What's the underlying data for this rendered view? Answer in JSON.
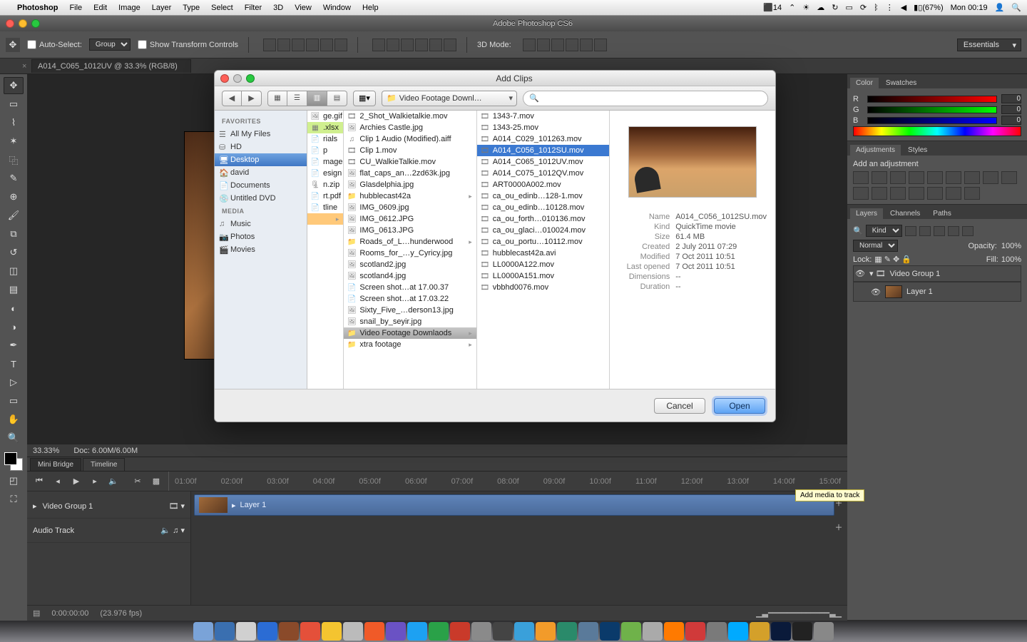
{
  "menubar": {
    "app": "Photoshop",
    "items": [
      "File",
      "Edit",
      "Image",
      "Layer",
      "Type",
      "Select",
      "Filter",
      "3D",
      "View",
      "Window",
      "Help"
    ],
    "right": {
      "adobe_badge": "14",
      "battery": "(67%)",
      "clock": "Mon 00:19"
    }
  },
  "window": {
    "title": "Adobe Photoshop CS6"
  },
  "optbar": {
    "auto_select": "Auto-Select:",
    "auto_select_value": "Group",
    "show_transform": "Show Transform Controls",
    "mode3d": "3D Mode:",
    "workspace": "Essentials"
  },
  "document_tab": "A014_C065_1012UV @ 33.3% (RGB/8)",
  "status": {
    "zoom": "33.33%",
    "doc": "Doc: 6.00M/6.00M"
  },
  "timeline": {
    "tabs": [
      "Mini Bridge",
      "Timeline"
    ],
    "ruler": [
      "01:00f",
      "02:00f",
      "03:00f",
      "04:00f",
      "05:00f",
      "06:00f",
      "07:00f",
      "08:00f",
      "09:00f",
      "10:00f",
      "11:00f",
      "12:00f",
      "13:00f",
      "14:00f",
      "15:00f"
    ],
    "video_group": "Video Group 1",
    "audio_track": "Audio Track",
    "clip_label": "Layer 1",
    "footer_time": "0:00:00:00",
    "footer_fps": "(23.976 fps)",
    "tooltip": "Add media to track"
  },
  "panels": {
    "color": {
      "tabs": [
        "Color",
        "Swatches"
      ],
      "r_label": "R",
      "g_label": "G",
      "b_label": "B",
      "r": "0",
      "g": "0",
      "b": "0"
    },
    "adjust": {
      "tabs": [
        "Adjustments",
        "Styles"
      ],
      "header": "Add an adjustment"
    },
    "layers": {
      "tabs": [
        "Layers",
        "Channels",
        "Paths"
      ],
      "kind": "Kind",
      "blend": "Normal",
      "opacity_label": "Opacity:",
      "opacity": "100%",
      "lock_label": "Lock:",
      "fill_label": "Fill:",
      "fill": "100%",
      "group": "Video Group 1",
      "layer": "Layer 1"
    }
  },
  "modal": {
    "title": "Add Clips",
    "path": "Video Footage Downl…",
    "sidebar": {
      "favorites": "FAVORITES",
      "items_fav": [
        "All My Files",
        "HD",
        "Desktop",
        "david",
        "Documents",
        "Untitled DVD"
      ],
      "media": "MEDIA",
      "items_media": [
        "Music",
        "Photos",
        "Movies"
      ],
      "selected": "Desktop"
    },
    "col0": [
      "ge.gif",
      ".xlsx",
      "rials",
      "p",
      "mage",
      "esign",
      "n.zip",
      "rt.pdf",
      "tline"
    ],
    "col1": [
      "2_Shot_Walkietalkie.mov",
      "Archies Castle.jpg",
      "Clip 1 Audio (Modified).aiff",
      "Clip 1.mov",
      "CU_WalkieTalkie.mov",
      "flat_caps_an…2zd63k.jpg",
      "Glasdelphia.jpg",
      "hubblecast42a",
      "IMG_0609.jpg",
      "IMG_0612.JPG",
      "IMG_0613.JPG",
      "Roads_of_L…hunderwood",
      "Rooms_for_…y_Cyricy.jpg",
      "scotland2.jpg",
      "scotland4.jpg",
      "Screen shot…at 17.00.37",
      "Screen shot…at 17.03.22",
      "Sixty_Five_…derson13.jpg",
      "snail_by_seyir.jpg",
      "Video Footage Downlaods",
      "xtra footage"
    ],
    "col1_selected": "Video Footage Downlaods",
    "col2": [
      "1343-7.mov",
      "1343-25.mov",
      "A014_C029_101263.mov",
      "A014_C056_1012SU.mov",
      "A014_C065_1012UV.mov",
      "A014_C075_1012QV.mov",
      "ART0000A002.mov",
      "ca_ou_edinb…128-1.mov",
      "ca_ou_edinb…10128.mov",
      "ca_ou_forth…010136.mov",
      "ca_ou_glaci…010024.mov",
      "ca_ou_portu…10112.mov",
      "hubblecast42a.avi",
      "LL0000A122.mov",
      "LL0000A151.mov",
      "vbbhd0076.mov"
    ],
    "col2_selected": "A014_C056_1012SU.mov",
    "preview": {
      "name_k": "Name",
      "name_v": "A014_C056_1012SU.mov",
      "kind_k": "Kind",
      "kind_v": "QuickTime movie",
      "size_k": "Size",
      "size_v": "61.4 MB",
      "created_k": "Created",
      "created_v": "2 July 2011 07:29",
      "modified_k": "Modified",
      "modified_v": "7 Oct 2011 10:51",
      "opened_k": "Last opened",
      "opened_v": "7 Oct 2011 10:51",
      "dim_k": "Dimensions",
      "dim_v": "--",
      "dur_k": "Duration",
      "dur_v": "--"
    },
    "cancel": "Cancel",
    "open": "Open"
  }
}
